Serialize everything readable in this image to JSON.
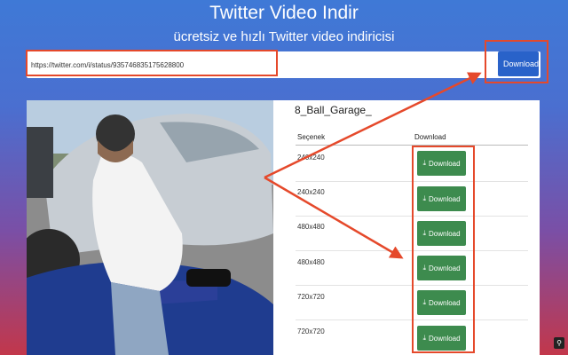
{
  "header": {
    "title": "Twitter Video Indir",
    "subtitle": "ücretsiz ve hızlı Twitter video indiricisi"
  },
  "search": {
    "value": "https://twitter.com/i/status/935746835175628800",
    "button_label": "Download"
  },
  "video": {
    "title": "8_Ball_Garage_",
    "table": {
      "headers": [
        "Seçenek",
        "Download"
      ],
      "rows": [
        {
          "option": "240x240",
          "button": "Download"
        },
        {
          "option": "240x240",
          "button": "Download"
        },
        {
          "option": "480x480",
          "button": "Download"
        },
        {
          "option": "480x480",
          "button": "Download"
        },
        {
          "option": "720x720",
          "button": "Download"
        },
        {
          "option": "720x720",
          "button": "Download"
        }
      ]
    }
  },
  "colors": {
    "annotation": "#e5492b",
    "primary_button": "#2962c9",
    "download_button": "#3d8b4e"
  },
  "icons": [
    "download-icon",
    "extension-icon"
  ]
}
